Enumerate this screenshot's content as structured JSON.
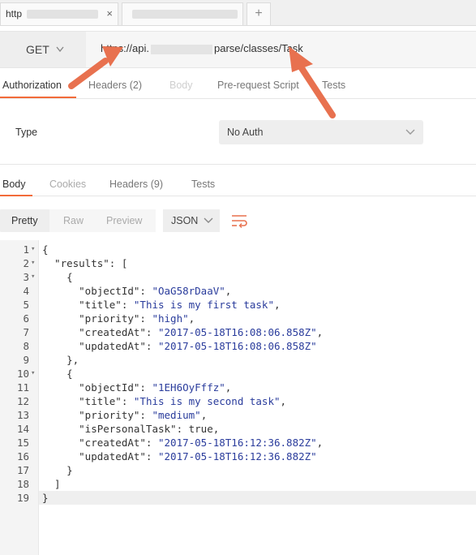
{
  "tabs": [
    {
      "label": "http",
      "close": "×"
    },
    {
      "label": ""
    }
  ],
  "new_tab": "+",
  "request": {
    "method": "GET",
    "url_prefix": "https://api.",
    "url_suffix": "parse/classes/Task"
  },
  "request_tabs": [
    "Authorization",
    "Headers (2)",
    "Body",
    "Pre-request Script",
    "Tests"
  ],
  "auth": {
    "type_label": "Type",
    "selected": "No Auth"
  },
  "response_tabs": [
    "Body",
    "Cookies",
    "Headers (9)",
    "Tests"
  ],
  "format": {
    "buttons": [
      "Pretty",
      "Raw",
      "Preview"
    ],
    "selected_format": "JSON"
  },
  "code": {
    "lines": [
      {
        "n": "1",
        "fold": true,
        "text": "{"
      },
      {
        "n": "2",
        "fold": true,
        "text": "  \"results\": ["
      },
      {
        "n": "3",
        "fold": true,
        "text": "    {"
      },
      {
        "n": "4",
        "fold": false,
        "key": "      \"objectId\": ",
        "val": "\"OaG58rDaaV\"",
        "tail": ","
      },
      {
        "n": "5",
        "fold": false,
        "key": "      \"title\": ",
        "val": "\"This is my first task\"",
        "tail": ","
      },
      {
        "n": "6",
        "fold": false,
        "key": "      \"priority\": ",
        "val": "\"high\"",
        "tail": ","
      },
      {
        "n": "7",
        "fold": false,
        "key": "      \"createdAt\": ",
        "val": "\"2017-05-18T16:08:06.858Z\"",
        "tail": ","
      },
      {
        "n": "8",
        "fold": false,
        "key": "      \"updatedAt\": ",
        "val": "\"2017-05-18T16:08:06.858Z\"",
        "tail": ""
      },
      {
        "n": "9",
        "fold": false,
        "text": "    },"
      },
      {
        "n": "10",
        "fold": true,
        "text": "    {"
      },
      {
        "n": "11",
        "fold": false,
        "key": "      \"objectId\": ",
        "val": "\"1EH6OyFffz\"",
        "tail": ","
      },
      {
        "n": "12",
        "fold": false,
        "key": "      \"title\": ",
        "val": "\"This is my second task\"",
        "tail": ","
      },
      {
        "n": "13",
        "fold": false,
        "key": "      \"priority\": ",
        "val": "\"medium\"",
        "tail": ","
      },
      {
        "n": "14",
        "fold": false,
        "text": "      \"isPersonalTask\": true,"
      },
      {
        "n": "15",
        "fold": false,
        "key": "      \"createdAt\": ",
        "val": "\"2017-05-18T16:12:36.882Z\"",
        "tail": ","
      },
      {
        "n": "16",
        "fold": false,
        "key": "      \"updatedAt\": ",
        "val": "\"2017-05-18T16:12:36.882Z\"",
        "tail": ""
      },
      {
        "n": "17",
        "fold": false,
        "text": "    }"
      },
      {
        "n": "18",
        "fold": false,
        "text": "  ]"
      },
      {
        "n": "19",
        "fold": false,
        "text": "}"
      }
    ]
  },
  "colors": {
    "accent": "#f26b3a",
    "arrow": "#e8714f",
    "string": "#2a3c9c"
  }
}
